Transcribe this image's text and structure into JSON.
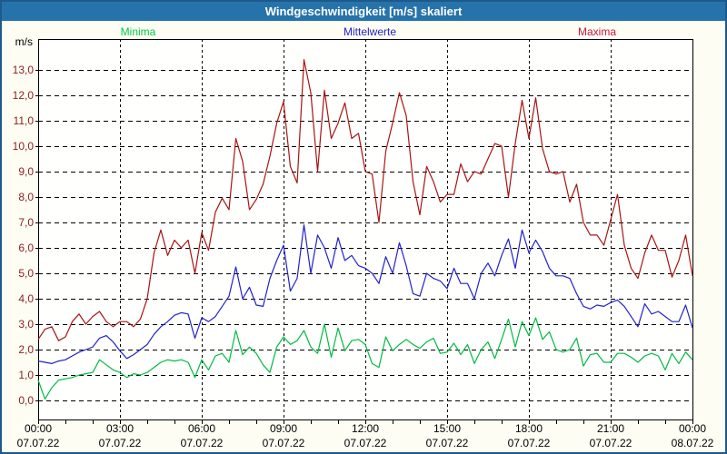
{
  "window": {
    "title": "Windgeschwindigkeit [m/s] skaliert"
  },
  "axis_unit": "m/s",
  "chart_data": {
    "type": "line",
    "title": "Windgeschwindigkeit [m/s] skaliert",
    "xlabel": "",
    "ylabel": "m/s",
    "x_unit": "hours",
    "x_range": [
      0,
      24
    ],
    "x_step_hours": 0.25,
    "y_range_displayed": [
      -0.75,
      14.21
    ],
    "y_gridlines": [
      0,
      1,
      2,
      3,
      4,
      5,
      6,
      7,
      8,
      9,
      10,
      11,
      12,
      13
    ],
    "y_tick_labels": [
      "0,0",
      "1,0",
      "2,0",
      "3,0",
      "4,0",
      "5,0",
      "6,0",
      "7,0",
      "8,0",
      "9,0",
      "10,0",
      "11,0",
      "12,0",
      "13,0"
    ],
    "x_ticks": [
      {
        "x": 0,
        "time": "00:00",
        "date": "07.07.22"
      },
      {
        "x": 3,
        "time": "03:00",
        "date": "07.07.22"
      },
      {
        "x": 6,
        "time": "06:00",
        "date": "07.07.22"
      },
      {
        "x": 9,
        "time": "09:00",
        "date": "07.07.22"
      },
      {
        "x": 12,
        "time": "12:00",
        "date": "07.07.22"
      },
      {
        "x": 15,
        "time": "15:00",
        "date": "07.07.22"
      },
      {
        "x": 18,
        "time": "18:00",
        "date": "07.07.22"
      },
      {
        "x": 21,
        "time": "21:00",
        "date": "07.07.22"
      },
      {
        "x": 24,
        "time": "00:00",
        "date": "08.07.22"
      }
    ],
    "minor_x_tick_every_hours": 1,
    "grid": "dashed-black",
    "legend_position": "top",
    "colors": {
      "frame": "#1d5a8a",
      "titlebar": "#2673ab",
      "background": "#fdfdf3",
      "plot_background": "#fffffd",
      "plot_border": "#000000",
      "y_label_color": "#8b2222",
      "x_label_color": "#000000"
    },
    "series": [
      {
        "name": "Minima",
        "color": "#00bb44",
        "label_color": "#00cc44",
        "values": [
          0.8,
          0.05,
          0.5,
          0.8,
          0.85,
          0.9,
          1.0,
          1.05,
          1.1,
          1.6,
          1.4,
          1.2,
          1.1,
          0.9,
          1.05,
          1.0,
          1.1,
          1.3,
          1.5,
          1.6,
          1.55,
          1.6,
          1.5,
          0.9,
          1.6,
          1.2,
          1.75,
          1.85,
          1.5,
          2.75,
          1.8,
          2.1,
          1.85,
          1.4,
          1.1,
          2.1,
          2.5,
          2.2,
          2.35,
          2.75,
          2.1,
          1.85,
          3.0,
          1.7,
          2.85,
          1.95,
          2.35,
          2.4,
          2.2,
          1.45,
          1.3,
          2.5,
          1.95,
          2.2,
          2.4,
          2.2,
          2.05,
          2.3,
          2.45,
          1.85,
          1.9,
          2.25,
          1.8,
          2.2,
          1.45,
          2.0,
          2.3,
          1.65,
          2.4,
          3.2,
          2.1,
          3.1,
          2.55,
          3.25,
          2.4,
          2.7,
          2.0,
          1.9,
          2.0,
          2.45,
          1.35,
          1.8,
          1.85,
          1.5,
          1.5,
          1.85,
          1.85,
          1.7,
          1.5,
          1.75,
          1.85,
          1.75,
          1.2,
          1.85,
          1.45,
          1.9,
          1.6
        ]
      },
      {
        "name": "Mittelwerte",
        "color": "#2222cc",
        "label_color": "#2222cc",
        "values": [
          1.55,
          1.5,
          1.45,
          1.55,
          1.6,
          1.75,
          1.9,
          2.0,
          2.1,
          2.45,
          2.55,
          2.3,
          1.95,
          1.65,
          1.8,
          2.0,
          2.2,
          2.6,
          2.9,
          3.1,
          3.35,
          3.45,
          3.4,
          2.45,
          3.25,
          3.1,
          3.3,
          3.7,
          4.1,
          5.25,
          4.0,
          4.45,
          3.75,
          3.7,
          4.8,
          5.5,
          6.1,
          4.3,
          4.8,
          6.9,
          5.0,
          6.5,
          6.0,
          5.2,
          6.4,
          5.5,
          5.7,
          5.3,
          5.2,
          5.0,
          4.6,
          5.65,
          5.0,
          6.2,
          5.3,
          4.2,
          4.1,
          5.0,
          4.8,
          4.7,
          4.4,
          5.2,
          4.6,
          4.6,
          4.0,
          5.0,
          5.4,
          4.9,
          5.7,
          6.35,
          5.2,
          6.7,
          5.8,
          6.3,
          5.85,
          5.2,
          4.9,
          4.9,
          4.8,
          4.2,
          3.7,
          3.6,
          3.75,
          3.7,
          3.85,
          3.95,
          3.7,
          3.3,
          2.9,
          3.8,
          3.4,
          3.5,
          3.3,
          3.1,
          3.1,
          3.75,
          2.85
        ]
      },
      {
        "name": "Maxima",
        "color": "#a81414",
        "label_color": "#c41744",
        "values": [
          2.4,
          2.8,
          2.9,
          2.35,
          2.5,
          3.1,
          3.4,
          3.0,
          3.3,
          3.5,
          3.1,
          2.9,
          3.1,
          3.1,
          2.9,
          3.2,
          4.0,
          5.8,
          6.7,
          5.7,
          6.3,
          6.0,
          6.3,
          5.0,
          6.6,
          5.9,
          7.4,
          7.95,
          7.5,
          10.3,
          9.4,
          7.5,
          7.9,
          8.5,
          9.6,
          10.9,
          11.75,
          9.2,
          8.55,
          13.4,
          12.1,
          9.0,
          12.2,
          10.3,
          10.9,
          11.7,
          10.3,
          10.5,
          9.0,
          8.9,
          7.0,
          9.8,
          10.9,
          12.1,
          11.2,
          8.6,
          7.3,
          9.2,
          8.6,
          7.8,
          8.1,
          8.1,
          9.3,
          8.6,
          9.0,
          8.9,
          9.5,
          10.1,
          10.0,
          8.0,
          10.1,
          11.8,
          10.3,
          11.9,
          9.9,
          9.0,
          8.9,
          9.0,
          7.8,
          8.5,
          7.0,
          6.5,
          6.5,
          6.1,
          7.1,
          8.1,
          6.1,
          5.2,
          4.8,
          5.8,
          6.5,
          5.9,
          5.9,
          4.85,
          5.5,
          6.5,
          4.9
        ]
      }
    ]
  }
}
